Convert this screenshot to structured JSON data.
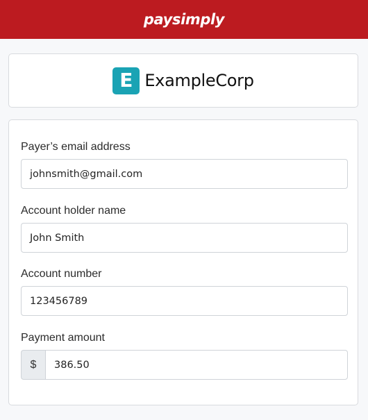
{
  "header": {
    "brand": "paysimply",
    "accent_color": "#bc1b20"
  },
  "merchant": {
    "logo_letter": "E",
    "logo_color": "#1aa3b4",
    "name": "ExampleCorp"
  },
  "form": {
    "email": {
      "label": "Payer’s email address",
      "value": "johnsmith@gmail.com"
    },
    "holder": {
      "label": "Account holder name",
      "value": "John Smith"
    },
    "account": {
      "label": "Account number",
      "value": "123456789"
    },
    "amount": {
      "label": "Payment amount",
      "currency": "$",
      "value": "386.50"
    }
  }
}
